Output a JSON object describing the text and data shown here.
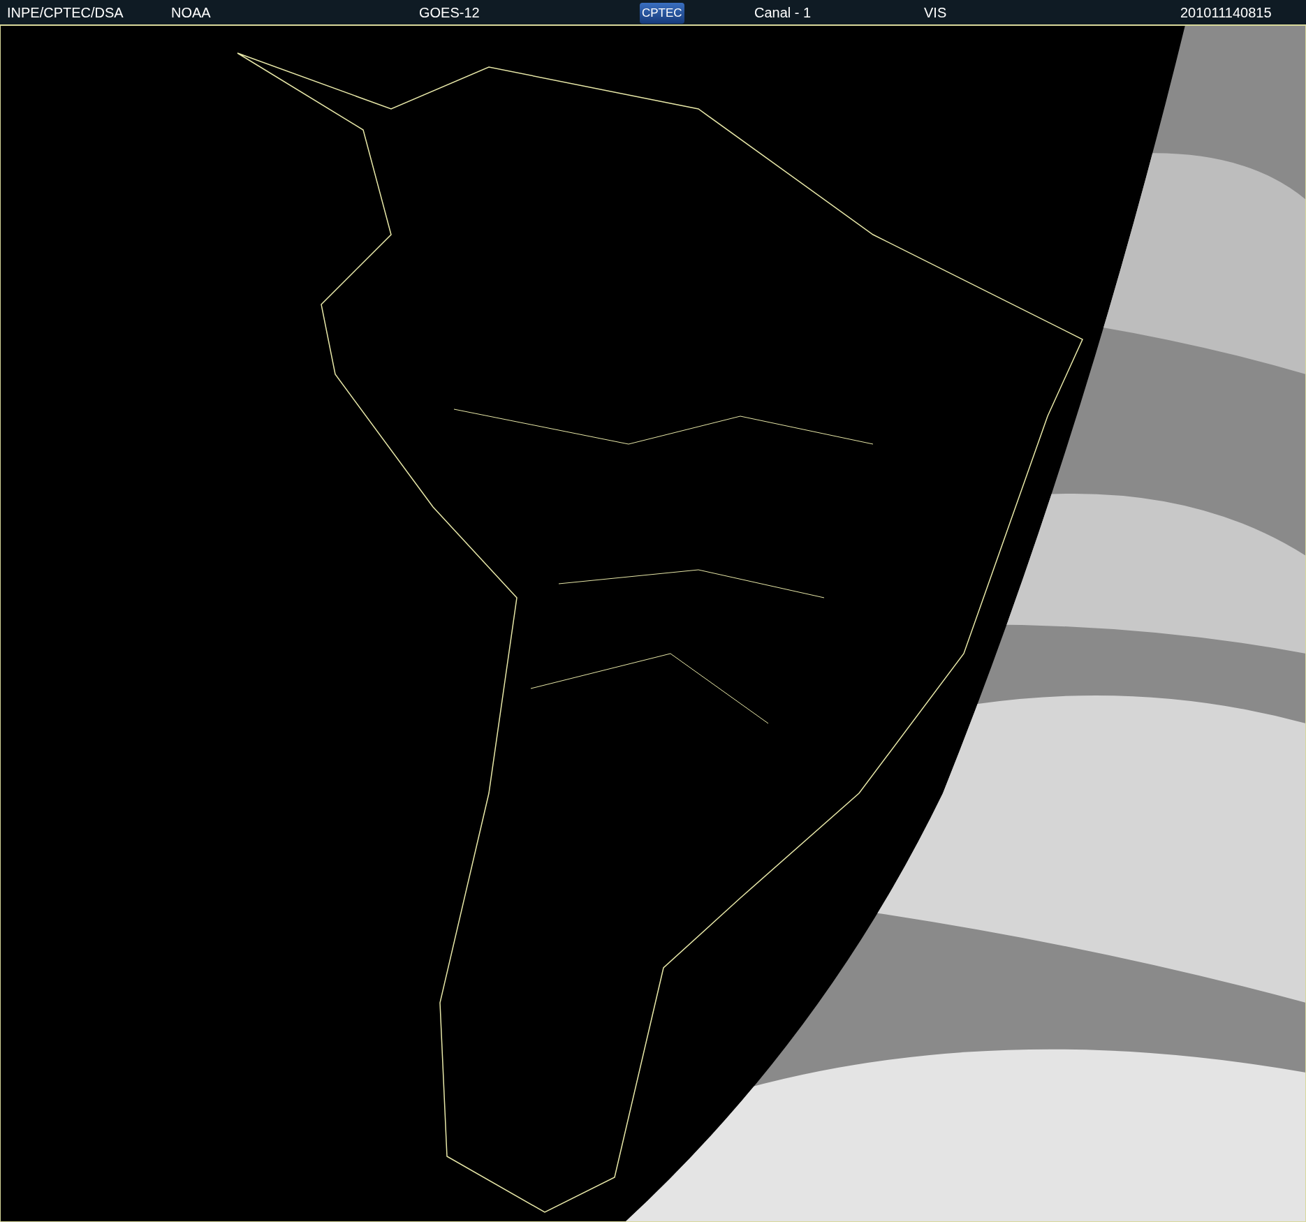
{
  "header": {
    "source": "INPE/CPTEC/DSA",
    "agency": "NOAA",
    "satellite": "GOES-12",
    "logo": "CPTEC",
    "channel": "Canal - 1",
    "band": "VIS",
    "timestamp": "201011140815"
  }
}
